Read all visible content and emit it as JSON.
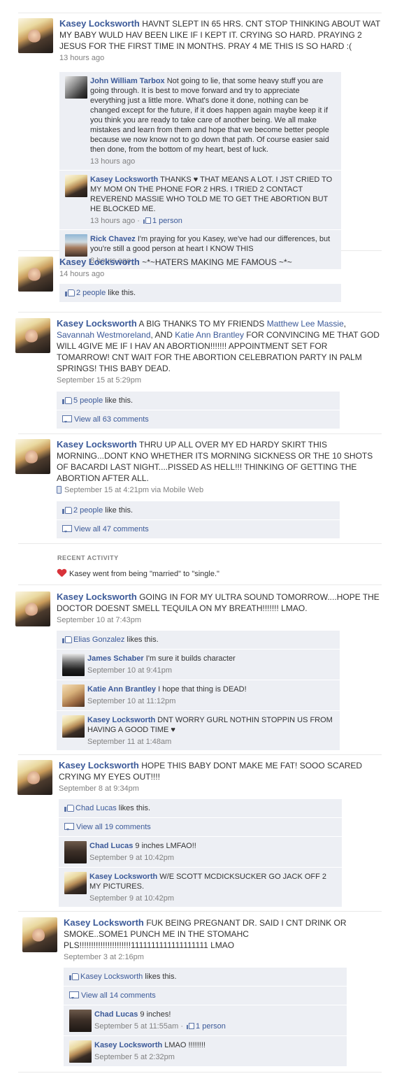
{
  "stories": [
    {
      "author": "Kasey Locksworth",
      "text": "HAVNT SLEPT IN 65 HRS. CNT STOP THINKING ABOUT WAT MY BABY WULD HAV BEEN LIKE IF I KEPT IT. CRYING SO HARD. PRAYING 2 JESUS FOR THE FIRST TIME IN MONTHS. PRAY 4 ME THIS IS SO HARD :(",
      "time": "13 hours ago",
      "comments": [
        {
          "name": "John William Tarbox",
          "text": "Not going to lie, that some heavy stuff you are going through. It is best to move forward and try to appreciate everything just a little more. What's done it done, nothing can be changed except for the future, if it does happen again maybe keep it if you think you are ready to take care of another being. We all make mistakes and learn from them and hope that we become better people because we now know not to go down that path. Of course easier said then done, from the bottom of my heart, best of luck.",
          "time": "13 hours ago"
        },
        {
          "name": "Kasey Locksworth",
          "text": "THANKS ♥ THAT MEANS A LOT. I JST CRIED TO MY MOM ON THE PHONE FOR 2 HRS. I TRIED 2 CONTACT REVEREND MASSIE WHO TOLD ME TO GET THE ABORTION BUT HE BLOCKED ME.",
          "time": "13 hours ago",
          "likes": "1 person"
        },
        {
          "name": "Rick Chavez",
          "text": "I'm praying for you Kasey, we've had our differences, but you're still a good person at heart I KNOW THIS",
          "time": "8 hours ago"
        }
      ]
    },
    {
      "author": "Kasey Locksworth",
      "text": "~*~HATERS MAKING ME FAMOUS ~*~",
      "time": "14 hours ago",
      "like_link": "2 people",
      "like_rest": " like this."
    },
    {
      "author": "Kasey Locksworth",
      "text_1": "A BIG THANKS TO MY FRIENDS ",
      "friend_1": "Matthew Lee Massie",
      "text_2": ", ",
      "friend_2": "Savannah Westmoreland",
      "text_3": ", AND ",
      "friend_3": "Katie Ann Brantley",
      "text_4": " FOR CONVINCING ME THAT GOD WILL 4GIVE ME IF I HAV AN ABORTION!!!!!!! APPOINTMENT SET FOR TOMARROW! CNT WAIT FOR THE ABORTION CELEBRATION PARTY IN PALM SPRINGS! THIS BABY DEAD.",
      "time": "September 15 at 5:29pm",
      "like_link": "5 people",
      "like_rest": " like this.",
      "view_all": "View all 63 comments"
    },
    {
      "author": "Kasey Locksworth",
      "text": "THRU UP ALL OVER MY ED HARDY SKIRT THIS MORNING...DONT KNO WHETHER ITS MORNING SICKNESS OR THE 10 SHOTS OF BACARDI LAST NIGHT....PISSED AS HELL!!! THINKING OF GETTING THE ABORTION AFTER ALL.",
      "time": "September 15 at 4:21pm",
      "via_prefix": " via ",
      "via": "Mobile Web",
      "like_link": "2 people",
      "like_rest": " like this.",
      "view_all": "View all 47 comments"
    },
    {
      "author": "Kasey Locksworth",
      "text": "GOING IN FOR MY ULTRA SOUND TOMORROW....HOPE THE DOCTOR DOESNT SMELL TEQUILA ON MY BREATH!!!!!!! LMAO.",
      "time": "September 10 at 7:43pm",
      "like_link": "Elias Gonzalez",
      "like_rest": " likes this.",
      "comments": [
        {
          "name": "James Schaber",
          "text": "I'm sure it builds character",
          "time": "September 10 at 9:41pm"
        },
        {
          "name": "Katie Ann Brantley",
          "text": "I hope that thing is DEAD!",
          "time": "September 10 at 11:12pm"
        },
        {
          "name": "Kasey Locksworth",
          "text": "DNT WORRY GURL NOTHIN STOPPIN US FROM HAVING A GOOD TIME ♥",
          "time": "September 11 at 1:48am"
        }
      ]
    },
    {
      "author": "Kasey Locksworth",
      "text": "HOPE THIS BABY DONT MAKE ME FAT! SOOO SCARED CRYING MY EYES OUT!!!!",
      "time": "September 8 at 9:34pm",
      "like_link": "Chad Lucas",
      "like_rest": " likes this.",
      "view_all": "View all 19 comments",
      "comments": [
        {
          "name": "Chad Lucas",
          "text": "9 inches LMFAO!!",
          "time": "September 9 at 10:42pm"
        },
        {
          "name": "Kasey Locksworth",
          "text": "W/E SCOTT MCDICKSUCKER GO JACK OFF 2 MY PICTURES.",
          "time": "September 9 at 10:42pm"
        }
      ]
    },
    {
      "author": "Kasey Locksworth",
      "text": "FUK BEING PREGNANT DR. SAID I CNT DRINK OR SMOKE..SOME1 PUNCH ME IN THE STOMAHC PLS!!!!!!!!!!!!!!!!!!!!!!1111111111111111111 LMAO",
      "time": "September 3 at 2:16pm",
      "like_link": "Kasey Locksworth",
      "like_rest": " likes this.",
      "view_all": "View all 14 comments",
      "comments": [
        {
          "name": "Chad Lucas",
          "text": "9 inches!",
          "time": "September 5 at 11:55am",
          "likes": "1 person"
        },
        {
          "name": "Kasey Locksworth",
          "text": "LMAO !!!!!!!!",
          "time": "September 5 at 2:32pm"
        }
      ]
    }
  ],
  "recent": {
    "title": "RECENT ACTIVITY",
    "text": "Kasey went from being \"married\" to \"single.\""
  }
}
